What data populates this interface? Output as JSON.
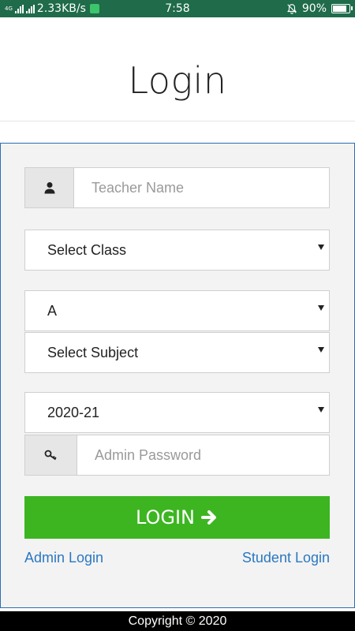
{
  "status_bar": {
    "network_type": "4G",
    "speed": "2.33KB/s",
    "time": "7:58",
    "battery": "90%",
    "battery_level": 0.9
  },
  "page": {
    "title": "Login"
  },
  "form": {
    "teacher_name": {
      "placeholder": "Teacher Name",
      "icon": "user-icon"
    },
    "class_select": {
      "value": "Select Class"
    },
    "section_select": {
      "value": "A"
    },
    "subject_select": {
      "value": "Select Subject"
    },
    "year_select": {
      "value": "2020-21"
    },
    "admin_password": {
      "placeholder": "Admin Password",
      "icon": "key-icon"
    },
    "login_button": {
      "label": "LOGIN",
      "icon": "arrow-right-icon"
    }
  },
  "links": {
    "admin_login": "Admin Login",
    "student_login": "Student Login"
  },
  "footer": {
    "copyright": "Copyright © 2020"
  },
  "colors": {
    "status_bar": "#1f6b4a",
    "primary_button": "#3cb521",
    "link": "#2a78c2",
    "panel_border": "#2a6fb3"
  }
}
